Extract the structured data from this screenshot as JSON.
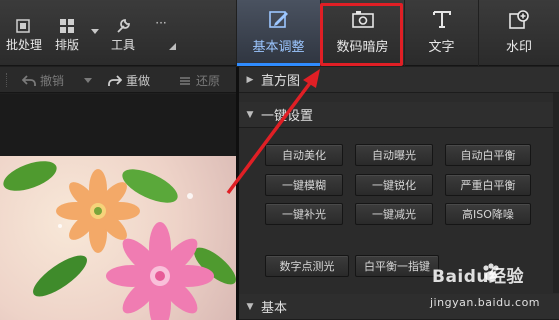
{
  "toolbar": {
    "batch_label": "批处理",
    "layout_label": "排版",
    "tools_label": "工具",
    "more_glyph": "···"
  },
  "mode_tabs": [
    {
      "label": "基本调整",
      "icon": "adjust-pencil-icon"
    },
    {
      "label": "数码暗房",
      "icon": "camera-icon"
    },
    {
      "label": "文字",
      "icon": "text-t-icon"
    },
    {
      "label": "水印",
      "icon": "watermark-plus-icon"
    }
  ],
  "history": {
    "undo_label": "撤销",
    "redo_label": "重做",
    "restore_label": "还原"
  },
  "panel": {
    "histogram_label": "直方图",
    "one_click_label": "一键设置",
    "basic_label": "基本",
    "one_click_buttons": [
      [
        "自动美化",
        "自动曝光",
        "自动白平衡"
      ],
      [
        "一键模糊",
        "一键锐化",
        "严重白平衡"
      ],
      [
        "一键补光",
        "一键减光",
        "高ISO降噪"
      ]
    ],
    "extra_buttons": [
      "数字点测光",
      "白平衡一指键"
    ]
  },
  "watermark": {
    "logo_text": "Baidu经验",
    "sub_text": "jingyan.baidu.com"
  },
  "colors": {
    "annotation_red": "#e01f25",
    "active_tab_text": "#9cc6ff",
    "accent_blue": "#2f8cff"
  }
}
